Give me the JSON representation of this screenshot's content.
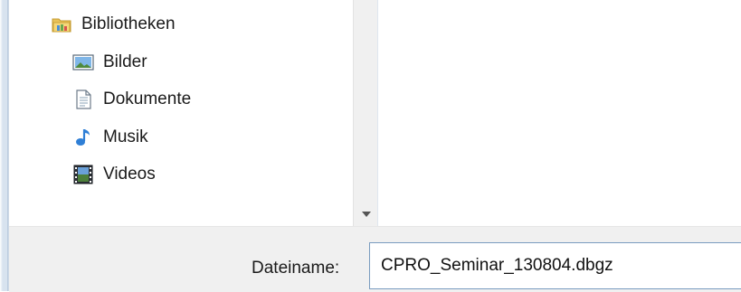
{
  "navigation": {
    "libraries_label": "Bibliotheken",
    "items": [
      {
        "label": "Bilder",
        "icon": "pictures-icon"
      },
      {
        "label": "Dokumente",
        "icon": "documents-icon"
      },
      {
        "label": "Musik",
        "icon": "music-icon"
      },
      {
        "label": "Videos",
        "icon": "videos-icon"
      }
    ]
  },
  "save": {
    "filename_label": "Dateiname:",
    "filename_value": "CPRO_Seminar_130804.dbgz"
  },
  "colors": {
    "folder_yellow": "#e8c25a",
    "note_blue": "#2f7fd6",
    "input_border": "#7a9cc0"
  }
}
